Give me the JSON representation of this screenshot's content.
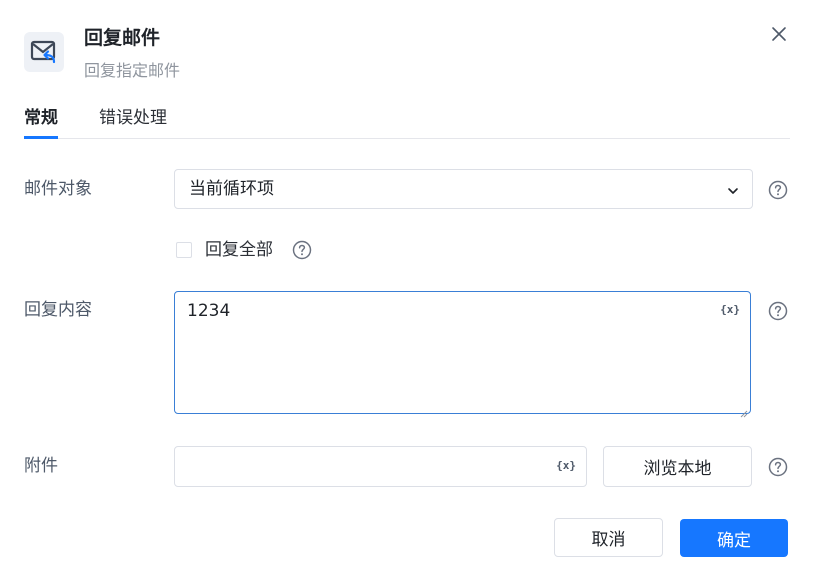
{
  "header": {
    "title": "回复邮件",
    "subtitle": "回复指定邮件",
    "icon": "mail-reply-icon"
  },
  "tabs": [
    {
      "label": "常规",
      "active": true
    },
    {
      "label": "错误处理",
      "active": false
    }
  ],
  "form": {
    "mail_object": {
      "label": "邮件对象",
      "value": "当前循环项"
    },
    "reply_all": {
      "label": "回复全部",
      "checked": false
    },
    "reply_content": {
      "label": "回复内容",
      "value": "1234",
      "var_button": "{x}"
    },
    "attachment": {
      "label": "附件",
      "value": "",
      "var_button": "{x}",
      "browse_label": "浏览本地"
    }
  },
  "footer": {
    "cancel_label": "取消",
    "ok_label": "确定"
  },
  "colors": {
    "primary": "#1677ff",
    "border": "#dcdfe6",
    "muted_text": "#8f959e"
  }
}
